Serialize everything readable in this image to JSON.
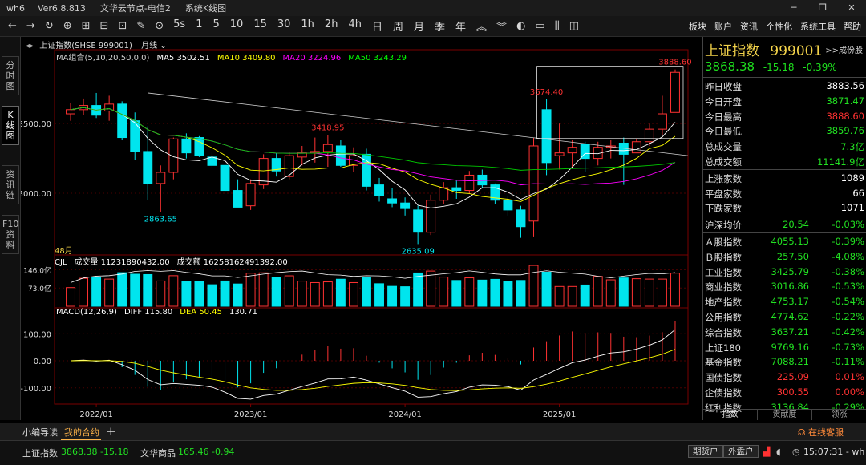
{
  "titlebar": {
    "app": "wh6",
    "version": "Ver6.8.813",
    "node": "文华云节点-电信2",
    "window": "系统K线图"
  },
  "toolbar": {
    "periods": [
      "5s",
      "1",
      "5",
      "10",
      "15",
      "30",
      "1h",
      "2h",
      "4h",
      "日",
      "周",
      "月",
      "季",
      "年"
    ],
    "right_menu": [
      "板块",
      "账户",
      "资讯",
      "个性化",
      "系统工具",
      "帮助"
    ]
  },
  "left_tabs": [
    {
      "label": "分\n时\n图"
    },
    {
      "label": "K\n线\n图"
    },
    {
      "label": "资\n讯\n链"
    },
    {
      "label": "F10\n资\n料"
    }
  ],
  "chart_header": {
    "name": "上证指数(SHSE 999001)",
    "period": "月线"
  },
  "ma_header": [
    {
      "text": "MA组合(5,10,20,50,0,0)",
      "color": "#d0d0d0"
    },
    {
      "text": "MA5 3502.51",
      "color": "#ffffff"
    },
    {
      "text": "MA10 3409.80",
      "color": "#ffff00"
    },
    {
      "text": "MA20 3224.96",
      "color": "#ff00ff"
    },
    {
      "text": "MA50 3243.29",
      "color": "#00ff00"
    }
  ],
  "vol_header": [
    {
      "text": "CJL",
      "color": "#ffffff"
    },
    {
      "text": "成交量 11231890432.00",
      "color": "#ffffff"
    },
    {
      "text": "成交额 16258162491392.00",
      "color": "#ffffff"
    }
  ],
  "macd_header": [
    {
      "text": "MACD(12,26,9)",
      "color": "#ffffff"
    },
    {
      "text": "DIFF 115.80",
      "color": "#ffffff"
    },
    {
      "text": "DEA 50.45",
      "color": "#ffff00"
    },
    {
      "text": "130.71",
      "color": "#ffffff"
    }
  ],
  "bar_count_label": "48月",
  "colors": {
    "up": "#ff3232",
    "down": "#00e5ee",
    "green": "#22e022",
    "yellow": "#f2d24a"
  },
  "chart_data": {
    "type": "candlestick",
    "x_axis_labels": [
      "2022/01",
      "2023/01",
      "2024/01",
      "2025/01"
    ],
    "price_axis": [
      3500.0,
      3000.0
    ],
    "volume_axis": [
      "146.0亿",
      "73.0亿"
    ],
    "macd_axis": [
      100.0,
      0.0,
      -100.0
    ],
    "annotations": [
      3888.6,
      3674.4,
      3418.95,
      2863.65,
      2635.09
    ],
    "candles": [
      {
        "o": 3570,
        "h": 3650,
        "l": 3520,
        "c": 3600
      },
      {
        "o": 3600,
        "h": 3680,
        "l": 3560,
        "c": 3630
      },
      {
        "o": 3630,
        "h": 3720,
        "l": 3540,
        "c": 3560
      },
      {
        "o": 3590,
        "h": 3700,
        "l": 3520,
        "c": 3640
      },
      {
        "o": 3640,
        "h": 3660,
        "l": 3380,
        "c": 3400
      },
      {
        "o": 3520,
        "h": 3580,
        "l": 3240,
        "c": 3300
      },
      {
        "o": 3300,
        "h": 3480,
        "l": 2950,
        "c": 3070
      },
      {
        "o": 3070,
        "h": 3200,
        "l": 2863.65,
        "c": 3150
      },
      {
        "o": 3150,
        "h": 3400,
        "l": 3100,
        "c": 3390
      },
      {
        "o": 3390,
        "h": 3430,
        "l": 3250,
        "c": 3290
      },
      {
        "o": 3400,
        "h": 3410,
        "l": 3260,
        "c": 3270
      },
      {
        "o": 3260,
        "h": 3300,
        "l": 3180,
        "c": 3200
      },
      {
        "o": 3200,
        "h": 3260,
        "l": 3010,
        "c": 3020
      },
      {
        "o": 3020,
        "h": 3100,
        "l": 2960,
        "c": 2900
      },
      {
        "o": 2910,
        "h": 3100,
        "l": 2880,
        "c": 3070
      },
      {
        "o": 3060,
        "h": 3280,
        "l": 3030,
        "c": 3250
      },
      {
        "o": 3250,
        "h": 3290,
        "l": 3120,
        "c": 3160
      },
      {
        "o": 3120,
        "h": 3300,
        "l": 3100,
        "c": 3270
      },
      {
        "o": 3260,
        "h": 3340,
        "l": 3200,
        "c": 3290
      },
      {
        "o": 3290,
        "h": 3400,
        "l": 3220,
        "c": 3300
      },
      {
        "o": 3300,
        "h": 3418.95,
        "l": 3190,
        "c": 3350
      },
      {
        "o": 3340,
        "h": 3380,
        "l": 3190,
        "c": 3200
      },
      {
        "o": 3200,
        "h": 3330,
        "l": 3150,
        "c": 3270
      },
      {
        "o": 3280,
        "h": 3320,
        "l": 3020,
        "c": 3050
      },
      {
        "o": 3060,
        "h": 3110,
        "l": 2940,
        "c": 2980
      },
      {
        "o": 2960,
        "h": 3040,
        "l": 2900,
        "c": 2930
      },
      {
        "o": 2930,
        "h": 2970,
        "l": 2840,
        "c": 2890
      },
      {
        "o": 2880,
        "h": 2910,
        "l": 2635.09,
        "c": 2720
      },
      {
        "o": 2720,
        "h": 2990,
        "l": 2700,
        "c": 2950
      },
      {
        "o": 2950,
        "h": 3080,
        "l": 2920,
        "c": 3040
      },
      {
        "o": 3040,
        "h": 3090,
        "l": 2960,
        "c": 3020
      },
      {
        "o": 3020,
        "h": 3160,
        "l": 3000,
        "c": 3130
      },
      {
        "o": 3130,
        "h": 3170,
        "l": 3040,
        "c": 3060
      },
      {
        "o": 3060,
        "h": 3070,
        "l": 2920,
        "c": 2950
      },
      {
        "o": 2950,
        "h": 2980,
        "l": 2840,
        "c": 2880
      },
      {
        "o": 2880,
        "h": 2910,
        "l": 2680,
        "c": 2760
      },
      {
        "o": 2800,
        "h": 3400,
        "l": 2690,
        "c": 3340
      },
      {
        "o": 3600,
        "h": 3674.4,
        "l": 3130,
        "c": 3220
      },
      {
        "o": 3270,
        "h": 3500,
        "l": 3170,
        "c": 3290
      },
      {
        "o": 3290,
        "h": 3380,
        "l": 3180,
        "c": 3330
      },
      {
        "o": 3350,
        "h": 3370,
        "l": 3150,
        "c": 3250
      },
      {
        "o": 3250,
        "h": 3370,
        "l": 3200,
        "c": 3330
      },
      {
        "o": 3330,
        "h": 3380,
        "l": 3250,
        "c": 3340
      },
      {
        "o": 3360,
        "h": 3400,
        "l": 3060,
        "c": 3280
      },
      {
        "o": 3290,
        "h": 3390,
        "l": 3290,
        "c": 3370
      },
      {
        "o": 3370,
        "h": 3500,
        "l": 3340,
        "c": 3460
      },
      {
        "o": 3460,
        "h": 3700,
        "l": 3420,
        "c": 3570
      },
      {
        "o": 3580,
        "h": 3888.6,
        "l": 3580,
        "c": 3868
      }
    ]
  },
  "quote": {
    "title": "上证指数",
    "code": "999001",
    "link": ">>成份股",
    "price": "3868.38",
    "change": "-15.18",
    "change_pct": "-0.39%",
    "rows1": [
      {
        "k": "昨日收盘",
        "v": "3883.56",
        "c": "#ffffff"
      },
      {
        "k": "今日开盘",
        "v": "3871.47",
        "c": "#22e022"
      },
      {
        "k": "今日最高",
        "v": "3888.60",
        "c": "#ff3232"
      },
      {
        "k": "今日最低",
        "v": "3859.76",
        "c": "#22e022"
      },
      {
        "k": "总成交量",
        "v": "7.3亿",
        "c": "#22e022"
      },
      {
        "k": "总成交额",
        "v": "11141.9亿",
        "c": "#22e022"
      }
    ],
    "rows2": [
      {
        "k": "上涨家数",
        "v": "1089",
        "c": "#ffffff"
      },
      {
        "k": "平盘家数",
        "v": "66",
        "c": "#ffffff"
      },
      {
        "k": "下跌家数",
        "v": "1071",
        "c": "#ffffff"
      }
    ],
    "hs_avg": {
      "k": "沪深均价",
      "v1": "20.54",
      "v2": "-0.03%"
    },
    "indices": [
      {
        "k": "Ａ股指数",
        "v1": "4055.13",
        "v2": "-0.39%",
        "c": "#22e022"
      },
      {
        "k": "Ｂ股指数",
        "v1": "257.50",
        "v2": "-4.08%",
        "c": "#22e022"
      },
      {
        "k": "工业指数",
        "v1": "3425.79",
        "v2": "-0.38%",
        "c": "#22e022"
      },
      {
        "k": "商业指数",
        "v1": "3016.86",
        "v2": "-0.53%",
        "c": "#22e022"
      },
      {
        "k": "地产指数",
        "v1": "4753.17",
        "v2": "-0.54%",
        "c": "#22e022"
      },
      {
        "k": "公用指数",
        "v1": "4774.62",
        "v2": "-0.22%",
        "c": "#22e022"
      },
      {
        "k": "综合指数",
        "v1": "3637.21",
        "v2": "-0.42%",
        "c": "#22e022"
      },
      {
        "k": "上证180",
        "v1": "9769.16",
        "v2": "-0.73%",
        "c": "#22e022"
      },
      {
        "k": "基金指数",
        "v1": "7088.21",
        "v2": "-0.11%",
        "c": "#22e022"
      },
      {
        "k": "国债指数",
        "v1": "225.09",
        "v2": "0.01%",
        "c": "#ff3232"
      },
      {
        "k": "企债指数",
        "v1": "300.55",
        "v2": "0.00%",
        "c": "#ff3232"
      },
      {
        "k": "红利指数",
        "v1": "3136.84",
        "v2": "-0.29%",
        "c": "#22e022"
      }
    ],
    "tabs": [
      "指数",
      "贡献度",
      "领涨"
    ]
  },
  "bottom_tabs": [
    "小编导读",
    "我的合约"
  ],
  "status": {
    "idx1_name": "上证指数",
    "idx1_val": "3868.38 -15.18",
    "idx2_name": "文华商品",
    "idx2_val": "165.46 -0.94",
    "btn1": "期货户",
    "btn2": "外盘户",
    "time": "15:07:31 - wh",
    "service": "在线客服"
  }
}
